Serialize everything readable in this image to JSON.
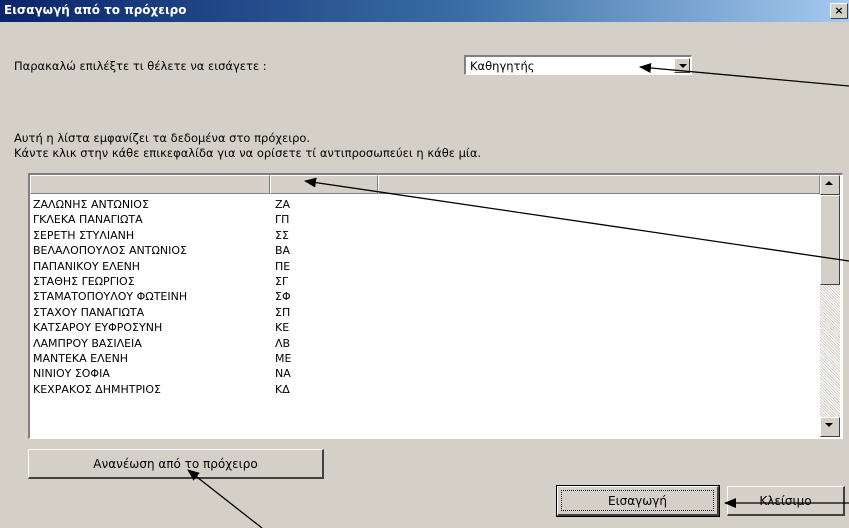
{
  "window": {
    "title": "Εισαγωγή από το πρόχειρο",
    "close_label": "×"
  },
  "prompt": {
    "label": "Παρακαλώ επιλέξτε τι θέλετε να εισάγετε :",
    "selected": "Καθηγητής"
  },
  "info": {
    "line1": "Αυτή η λίστα εμφανίζει τα δεδομένα στο πρόχειρο.",
    "line2": "Κάντε κλικ στην κάθε επικεφαλίδα για να ορίσετε τί αντιπροσωπεύει η κάθε μία."
  },
  "list": {
    "headers": [
      "",
      "",
      ""
    ],
    "rows": [
      [
        "ΖΑΛΩΝΗΣ ΑΝΤΩΝΙΟΣ",
        "ΖΑ"
      ],
      [
        "ΓΚΛΕΚΑ ΠΑΝΑΓΙΩΤΑ",
        "ΓΠ"
      ],
      [
        "ΣΕΡΕΤΗ ΣΤΥΛΙΑΝΗ",
        "ΣΣ"
      ],
      [
        "ΒΕΛΑΛΟΠΟΥΛΟΣ ΑΝΤΩΝΙΟΣ",
        "ΒΑ"
      ],
      [
        "ΠΑΠΑΝΙΚΟΥ ΕΛΕΝΗ",
        "ΠΕ"
      ],
      [
        "ΣΤΑΘΗΣ ΓΕΩΡΓΙΟΣ",
        "ΣΓ"
      ],
      [
        "ΣΤΑΜΑΤΟΠΟΥΛΟΥ ΦΩΤΕΙΝΗ",
        "ΣΦ"
      ],
      [
        "ΣΤΑΧΟΥ ΠΑΝΑΓΙΩΤΑ",
        "ΣΠ"
      ],
      [
        "ΚΑΤΣΑΡΟΥ ΕΥΦΡΟΣΥΝΗ",
        "ΚΕ"
      ],
      [
        "ΛΑΜΠΡΟΥ ΒΑΣΙΛΕΙΑ",
        "ΛΒ"
      ],
      [
        "ΜΑΝΤΕΚΑ ΕΛΕΝΗ",
        "ΜΕ"
      ],
      [
        "ΝΙΝΙΟΥ ΣΟΦΙΑ",
        "ΝΑ"
      ],
      [
        "ΚΕΧΡΑΚΟΣ ΔΗΜΗΤΡΙΟΣ",
        "ΚΔ"
      ]
    ]
  },
  "buttons": {
    "refresh": "Ανανέωση από το πρόχειρο",
    "import": "Εισαγωγή",
    "close": "Κλείσιμο"
  },
  "icons": [
    "close-icon",
    "dropdown-arrow-icon",
    "scroll-up-icon",
    "scroll-down-icon",
    "annotation-arrow"
  ],
  "colors": {
    "titlebar_start": "#0a246a",
    "titlebar_end": "#a6caf0",
    "face": "#d4d0c8"
  }
}
